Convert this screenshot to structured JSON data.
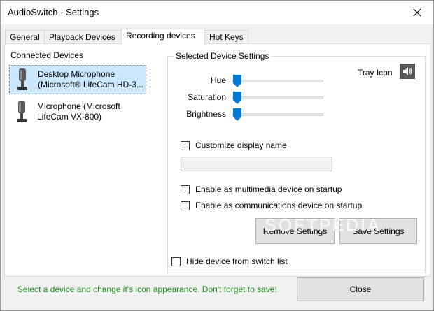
{
  "window": {
    "title": "AudioSwitch - Settings"
  },
  "tabs": [
    {
      "label": "General",
      "active": false
    },
    {
      "label": "Playback Devices",
      "active": false
    },
    {
      "label": "Recording devices",
      "active": true
    },
    {
      "label": "Hot Keys",
      "active": false
    }
  ],
  "connected_devices": {
    "title": "Connected Devices",
    "items": [
      {
        "line1": "Desktop Microphone",
        "line2": "(Microsoft® LifeCam HD-3...",
        "selected": true
      },
      {
        "line1": "Microphone (Microsoft",
        "line2": "LifeCam VX-800)",
        "selected": false
      }
    ]
  },
  "selected_settings": {
    "title": "Selected Device Settings",
    "tray_icon_label": "Tray Icon",
    "sliders": [
      {
        "label": "Hue",
        "value": 0
      },
      {
        "label": "Saturation",
        "value": 0
      },
      {
        "label": "Brightness",
        "value": 0
      }
    ],
    "customize_name_label": "Customize display name",
    "display_name_value": "",
    "multimedia_label": "Enable as multimedia device on startup",
    "communications_label": "Enable as communications device on startup",
    "remove_button": "Remove Settings",
    "save_button": "Save Settings"
  },
  "hide_device_label": "Hide device from switch list",
  "status_text": "Select a device and change it's icon appearance. Don't forget to save!",
  "close_button": "Close",
  "watermark": "SOFTPEDIA",
  "colors": {
    "accent": "#0078d7",
    "selection": "#cce8ff",
    "status_green": "#1f8f1f"
  }
}
